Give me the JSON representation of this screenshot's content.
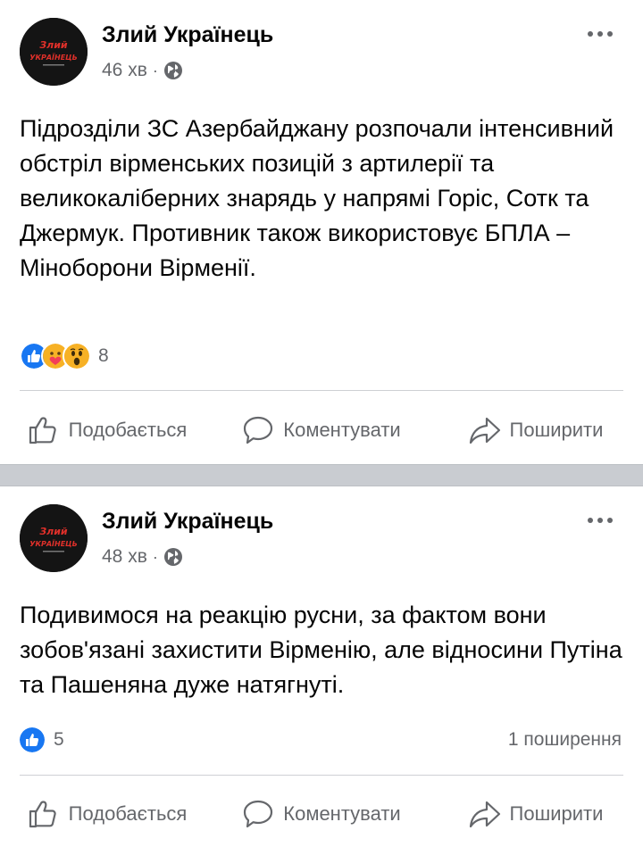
{
  "posts": [
    {
      "author": "Злий Українець",
      "avatar_text_line1": "Злий",
      "avatar_text_line2": "УКРАЇНЕЦЬ",
      "time": "46 хв",
      "privacy_icon": "globe-icon",
      "text": "Підрозділи ЗС Азербайджану розпочали інтенсивний обстріл вірменських позицій з артилерії та великокаліберних знарядь у напрямі Горіс, Сотк та Джермук. Противник також використовує БПЛА – Міноборони Вірменії.",
      "reactions": [
        "like",
        "care",
        "wow"
      ],
      "reaction_count": "8",
      "share_count": ""
    },
    {
      "author": "Злий Українець",
      "avatar_text_line1": "Злий",
      "avatar_text_line2": "УКРАЇНЕЦЬ",
      "time": "48 хв",
      "privacy_icon": "globe-icon",
      "text": "Подивимося на реакцію русни, за фактом вони зобов'язані захистити Вірменію, але відносини Путіна та Пашеняна дуже натягнуті.",
      "reactions": [
        "like"
      ],
      "reaction_count": "5",
      "share_count": "1 поширення"
    }
  ],
  "actions": {
    "like": "Подобається",
    "comment": "Коментувати",
    "share": "Поширити"
  },
  "colors": {
    "like_blue": "#1877f2",
    "text_secondary": "#65676b",
    "separator": "#c9ccd1",
    "avatar_red": "#e0302a"
  }
}
